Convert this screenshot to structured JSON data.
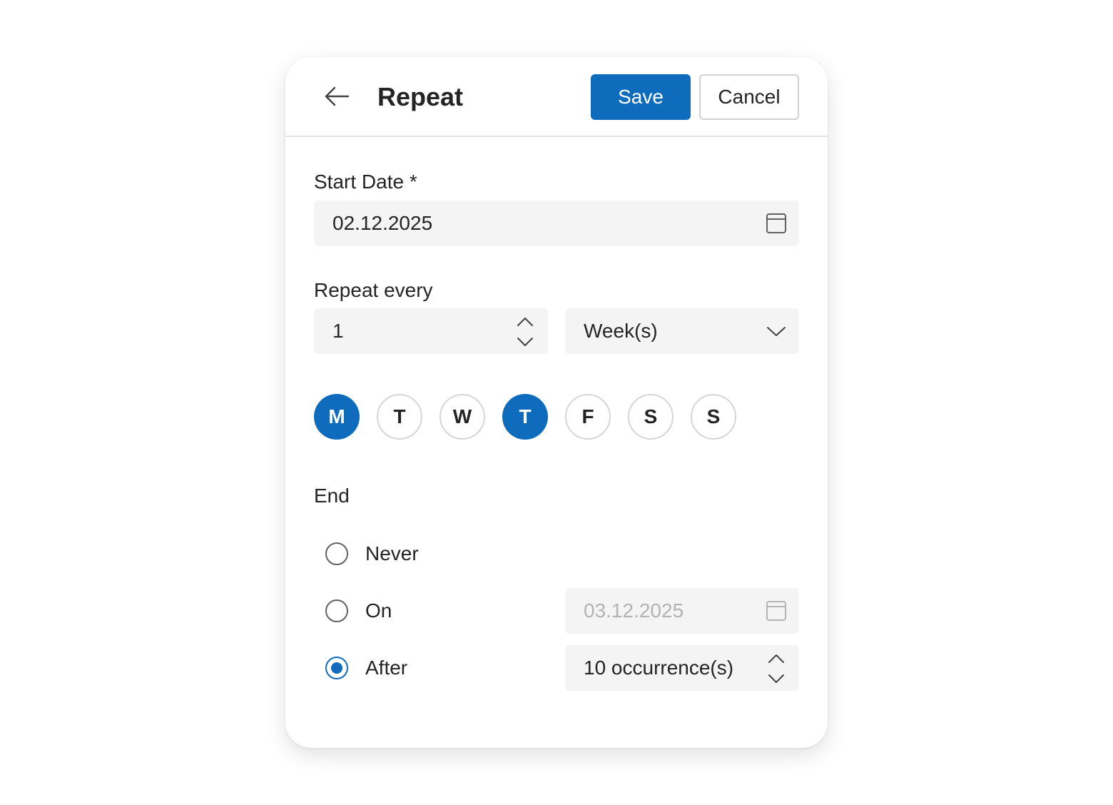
{
  "header": {
    "title": "Repeat",
    "save_label": "Save",
    "cancel_label": "Cancel"
  },
  "start_date": {
    "label": "Start Date *",
    "value": "02.12.2025"
  },
  "repeat_every": {
    "label": "Repeat every",
    "interval_value": "1",
    "unit_value": "Week(s)"
  },
  "weekdays": [
    {
      "label": "M",
      "selected": true
    },
    {
      "label": "T",
      "selected": false
    },
    {
      "label": "W",
      "selected": false
    },
    {
      "label": "T",
      "selected": true
    },
    {
      "label": "F",
      "selected": false
    },
    {
      "label": "S",
      "selected": false
    },
    {
      "label": "S",
      "selected": false
    }
  ],
  "end": {
    "label": "End",
    "options": [
      {
        "label": "Never",
        "checked": false
      },
      {
        "label": "On",
        "checked": false
      },
      {
        "label": "After",
        "checked": true
      }
    ],
    "on_date_value": "03.12.2025",
    "after_value": "10 occurrence(s)"
  },
  "colors": {
    "accent": "#0f6cbd",
    "field_bg": "#f4f4f4",
    "text": "#242424",
    "disabled_text": "#b3b3b3"
  },
  "icons": {
    "back": "arrow-left-icon",
    "calendar": "calendar-icon",
    "spin_up": "chevron-up-icon",
    "spin_down": "chevron-down-icon",
    "dropdown": "chevron-down-icon"
  }
}
